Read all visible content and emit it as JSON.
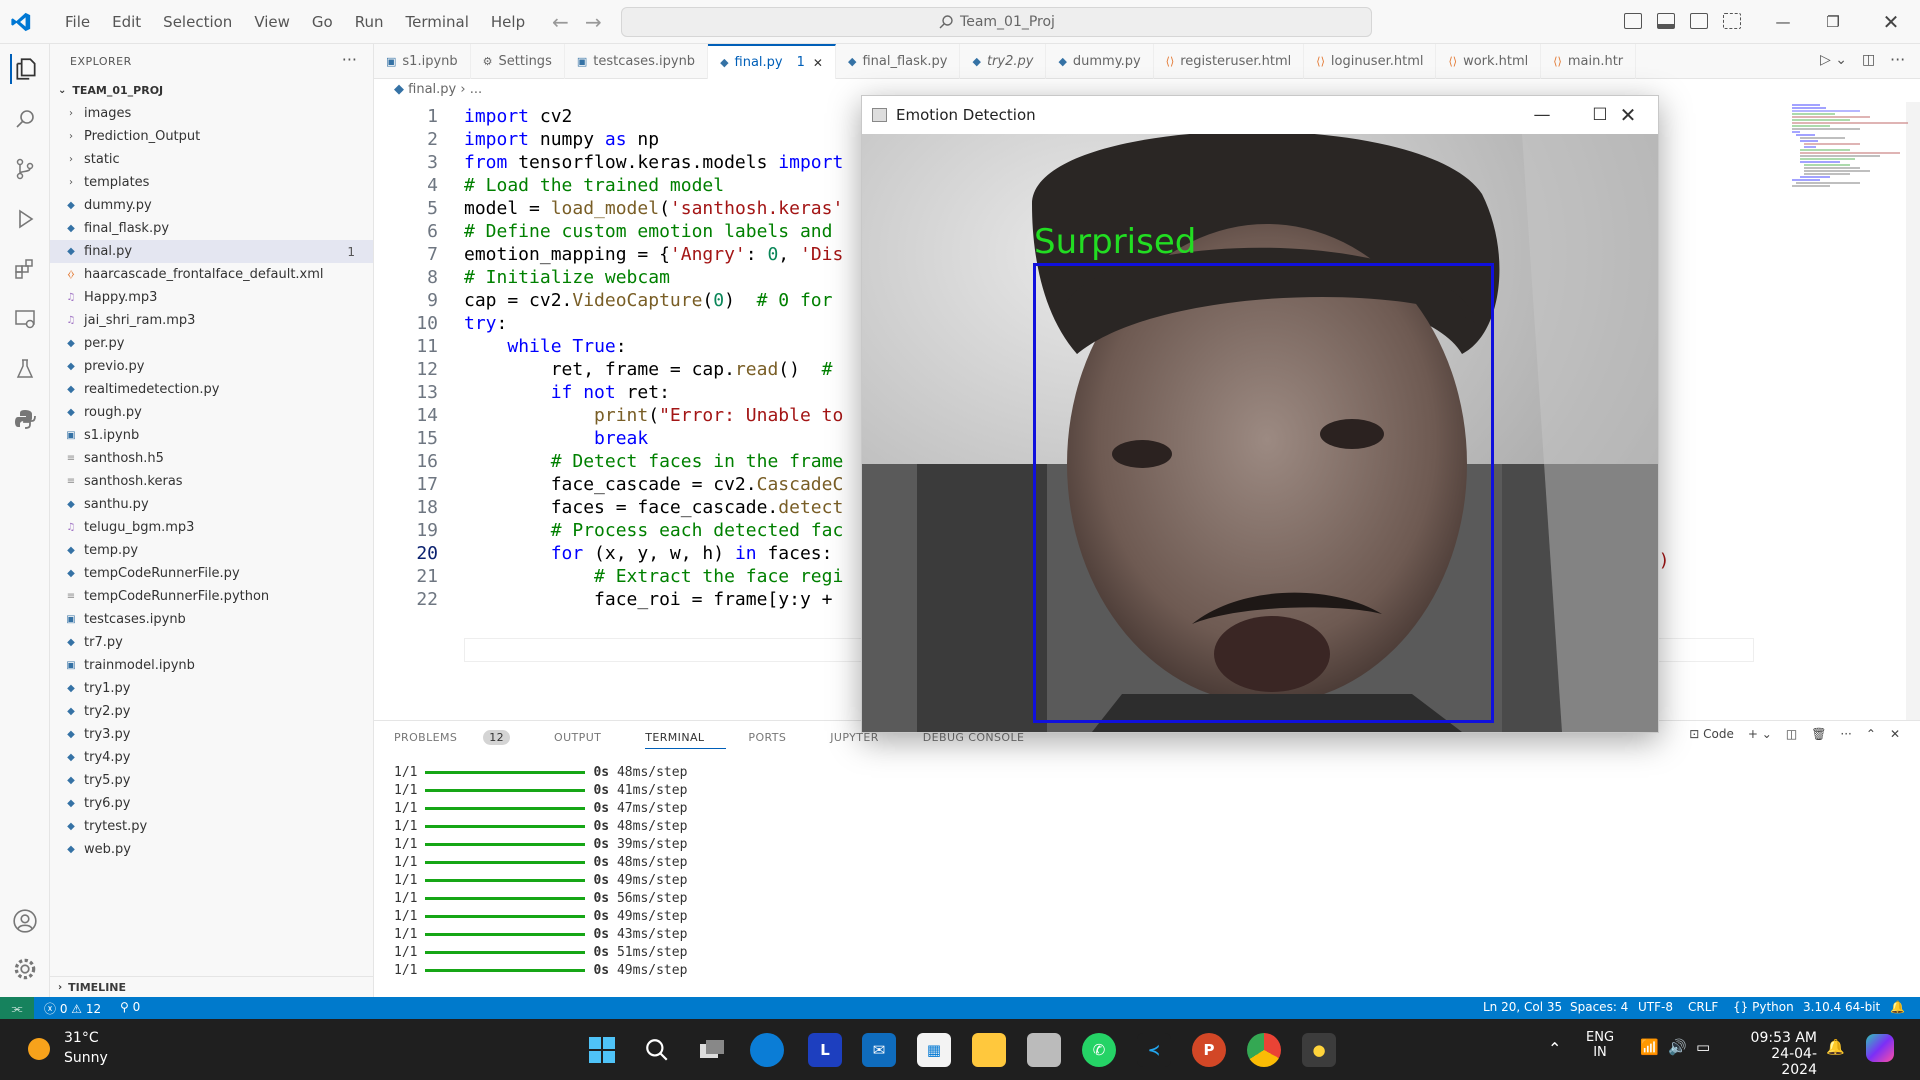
{
  "menu": [
    "File",
    "Edit",
    "Selection",
    "View",
    "Go",
    "Run",
    "Terminal",
    "Help"
  ],
  "search": {
    "text": "Team_01_Proj"
  },
  "sidebar": {
    "title": "EXPLORER",
    "project": "TEAM_01_PROJ",
    "items": [
      {
        "label": "images",
        "type": "folder"
      },
      {
        "label": "Prediction_Output",
        "type": "folder"
      },
      {
        "label": "static",
        "type": "folder"
      },
      {
        "label": "templates",
        "type": "folder"
      },
      {
        "label": "dummy.py",
        "type": "py"
      },
      {
        "label": "final_flask.py",
        "type": "py"
      },
      {
        "label": "final.py",
        "type": "py",
        "badge": "1",
        "selected": true
      },
      {
        "label": "haarcascade_frontalface_default.xml",
        "type": "xml"
      },
      {
        "label": "Happy.mp3",
        "type": "mp3"
      },
      {
        "label": "jai_shri_ram.mp3",
        "type": "mp3"
      },
      {
        "label": "per.py",
        "type": "py"
      },
      {
        "label": "previo.py",
        "type": "py"
      },
      {
        "label": "realtimedetection.py",
        "type": "py"
      },
      {
        "label": "rough.py",
        "type": "py"
      },
      {
        "label": "s1.ipynb",
        "type": "nb"
      },
      {
        "label": "santhosh.h5",
        "type": "file"
      },
      {
        "label": "santhosh.keras",
        "type": "file"
      },
      {
        "label": "santhu.py",
        "type": "py"
      },
      {
        "label": "telugu_bgm.mp3",
        "type": "mp3"
      },
      {
        "label": "temp.py",
        "type": "py"
      },
      {
        "label": "tempCodeRunnerFile.py",
        "type": "py"
      },
      {
        "label": "tempCodeRunnerFile.python",
        "type": "file"
      },
      {
        "label": "testcases.ipynb",
        "type": "nb"
      },
      {
        "label": "tr7.py",
        "type": "py"
      },
      {
        "label": "trainmodel.ipynb",
        "type": "nb"
      },
      {
        "label": "try1.py",
        "type": "py"
      },
      {
        "label": "try2.py",
        "type": "py"
      },
      {
        "label": "try3.py",
        "type": "py"
      },
      {
        "label": "try4.py",
        "type": "py"
      },
      {
        "label": "try5.py",
        "type": "py"
      },
      {
        "label": "try6.py",
        "type": "py"
      },
      {
        "label": "trytest.py",
        "type": "py"
      },
      {
        "label": "web.py",
        "type": "py"
      }
    ],
    "timeline": "TIMELINE"
  },
  "tabs": [
    {
      "label": "s1.ipynb",
      "icon": "nb"
    },
    {
      "label": "Settings",
      "icon": "settings"
    },
    {
      "label": "testcases.ipynb",
      "icon": "nb"
    },
    {
      "label": "final.py",
      "icon": "py",
      "active": true,
      "badge": "1"
    },
    {
      "label": "final_flask.py",
      "icon": "py"
    },
    {
      "label": "try2.py",
      "icon": "py",
      "italic": true
    },
    {
      "label": "dummy.py",
      "icon": "py"
    },
    {
      "label": "registeruser.html",
      "icon": "html"
    },
    {
      "label": "loginuser.html",
      "icon": "html"
    },
    {
      "label": "work.html",
      "icon": "html"
    },
    {
      "label": "main.htr",
      "icon": "html"
    }
  ],
  "breadcrumb": {
    "file": "final.py",
    "rest": "..."
  },
  "code_lines": [
    {
      "n": "1",
      "html": "<span class='kw'>import</span> cv2"
    },
    {
      "n": "2",
      "html": "<span class='kw'>import</span> numpy <span class='kw'>as</span> np"
    },
    {
      "n": "3",
      "html": "<span class='kw'>from</span> tensorflow.keras.models <span class='kw'>import</span>"
    },
    {
      "n": "4",
      "html": "<span class='cm'># Load the trained model</span>"
    },
    {
      "n": "5",
      "html": "model = <span class='fn'>load_model</span>(<span class='st'>'santhosh.keras'</span>"
    },
    {
      "n": "6",
      "html": "<span class='cm'># Define custom emotion labels and</span>"
    },
    {
      "n": "7",
      "html": "emotion_mapping = {<span class='st'>'Angry'</span>: <span class='nm'>0</span>, <span class='st'>'Dis</span>"
    },
    {
      "n": "8",
      "html": "<span class='cm'># Initialize webcam</span>"
    },
    {
      "n": "9",
      "html": "cap = cv2.<span class='fn'>VideoCapture</span>(<span class='nm'>0</span>)  <span class='cm'># 0 for</span>"
    },
    {
      "n": "10",
      "html": "<span class='kw'>try</span>:"
    },
    {
      "n": "11",
      "html": "    <span class='kw'>while</span> <span class='kw'>True</span>:"
    },
    {
      "n": "12",
      "html": "        ret, frame = cap.<span class='fn'>read</span>()  <span class='cm'>#</span>"
    },
    {
      "n": "13",
      "html": "        <span class='kw'>if not</span> ret:"
    },
    {
      "n": "14",
      "html": "            <span class='fn'>print</span>(<span class='st'>\"Error: Unable to</span>"
    },
    {
      "n": "15",
      "html": "            <span class='kw'>break</span>"
    },
    {
      "n": "16",
      "html": "        <span class='cm'># Detect faces in the frame</span>"
    },
    {
      "n": "17",
      "html": "        face_cascade = cv2.<span class='fn'>CascadeC</span>"
    },
    {
      "n": "18",
      "html": "        faces = face_cascade.<span class='fn'>detect</span>"
    },
    {
      "n": "19",
      "html": "        <span class='cm'># Process each detected fac</span>"
    },
    {
      "n": "20",
      "html": "        <span class='kw'>for</span> (x, y, w, h) <span class='kw'>in</span> faces:"
    },
    {
      "n": "21",
      "html": "            <span class='cm'># Extract the face regi</span>"
    },
    {
      "n": "22",
      "html": "            face_roi = frame[y:y +"
    }
  ],
  "code_right": {
    "line7": "6}",
    "line17": "1')"
  },
  "panel": {
    "tabs": [
      "PROBLEMS",
      "OUTPUT",
      "TERMINAL",
      "PORTS",
      "JUPYTER",
      "DEBUG CONSOLE"
    ],
    "problems_count": "12",
    "code_label": "Code",
    "terminal": [
      {
        "step": "1/1",
        "time": "0s",
        "rate": "48ms/step"
      },
      {
        "step": "1/1",
        "time": "0s",
        "rate": "41ms/step"
      },
      {
        "step": "1/1",
        "time": "0s",
        "rate": "47ms/step"
      },
      {
        "step": "1/1",
        "time": "0s",
        "rate": "48ms/step"
      },
      {
        "step": "1/1",
        "time": "0s",
        "rate": "39ms/step"
      },
      {
        "step": "1/1",
        "time": "0s",
        "rate": "48ms/step"
      },
      {
        "step": "1/1",
        "time": "0s",
        "rate": "49ms/step"
      },
      {
        "step": "1/1",
        "time": "0s",
        "rate": "56ms/step"
      },
      {
        "step": "1/1",
        "time": "0s",
        "rate": "49ms/step"
      },
      {
        "step": "1/1",
        "time": "0s",
        "rate": "43ms/step"
      },
      {
        "step": "1/1",
        "time": "0s",
        "rate": "51ms/step"
      },
      {
        "step": "1/1",
        "time": "0s",
        "rate": "49ms/step"
      }
    ]
  },
  "emotion_window": {
    "title": "Emotion Detection",
    "label": "Surprised"
  },
  "status": {
    "errors": "0",
    "warnings": "12",
    "ports": "0",
    "position": "Ln 20, Col 35",
    "spaces": "Spaces: 4",
    "encoding": "UTF-8",
    "eol": "CRLF",
    "language": "Python",
    "interpreter": "3.10.4 64-bit"
  },
  "taskbar": {
    "temp": "31°C",
    "weather": "Sunny",
    "lang1": "ENG",
    "lang2": "IN",
    "time": "09:53 AM",
    "date": "24-04-2024"
  },
  "colors": {
    "accent": "#007acc",
    "face_box": "#1010dd",
    "emotion_label": "#22dd22",
    "progress": "#16a616"
  }
}
